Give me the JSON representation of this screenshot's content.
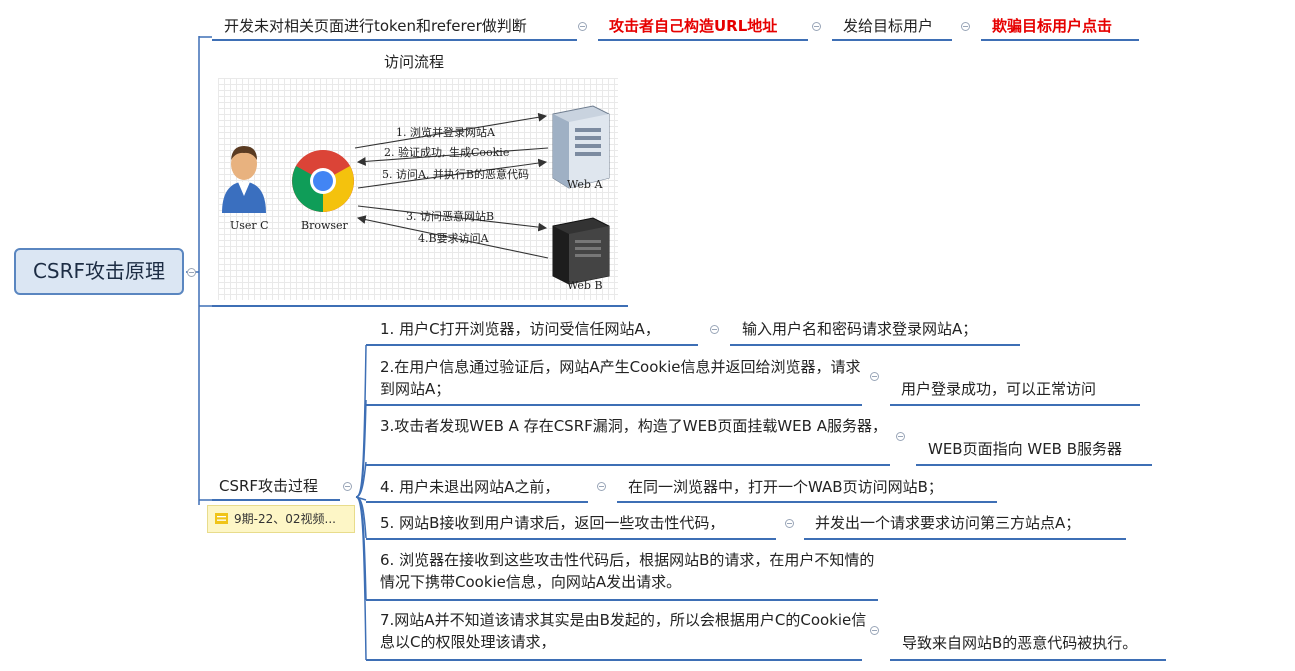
{
  "root": {
    "label": "CSRF攻击原理"
  },
  "top_branch": {
    "step1": "开发未对相关页面进行token和referer做判断",
    "step2": "攻击者自己构造URL地址",
    "step3": "发给目标用户",
    "step4": "欺骗目标用户点击"
  },
  "flow": {
    "title": "访问流程",
    "diagram": {
      "user_label": "User C",
      "browser_label": "Browser",
      "weba_label": "Web A",
      "webb_label": "Web B",
      "arrow1": "1. 浏览并登录网站A",
      "arrow2": "2. 验证成功, 生成Cookie",
      "arrow5": "5. 访问A, 并执行B的恶意代码",
      "arrow3": "3. 访问恶意网站B",
      "arrow4": "4.B要求访问A"
    }
  },
  "process": {
    "label": "CSRF攻击过程",
    "note": "9期-22、02视频...",
    "items": [
      {
        "text": "1. 用户C打开浏览器，访问受信任网站A，",
        "child": "输入用户名和密码请求登录网站A；"
      },
      {
        "text": "2.在用户信息通过验证后，网站A产生Cookie信息并返回给浏览器，请求到网站A；",
        "child": "用户登录成功，可以正常访问"
      },
      {
        "text": "3.攻击者发现WEB A 存在CSRF漏洞，构造了WEB页面挂载WEB A服务器，",
        "child": "WEB页面指向 WEB B服务器"
      },
      {
        "text": "4. 用户未退出网站A之前，",
        "child": "在同一浏览器中，打开一个WAB页访问网站B；"
      },
      {
        "text": "5. 网站B接收到用户请求后，返回一些攻击性代码，",
        "child": "并发出一个请求要求访问第三方站点A；"
      },
      {
        "text": "6. 浏览器在接收到这些攻击性代码后，根据网站B的请求，在用户不知情的情况下携带Cookie信息，向网站A发出请求。"
      },
      {
        "text": "7.网站A并不知道该请求其实是由B发起的，所以会根据用户C的Cookie信息以C的权限处理该请求，",
        "child": "导致来自网站B的恶意代码被执行。"
      }
    ]
  }
}
